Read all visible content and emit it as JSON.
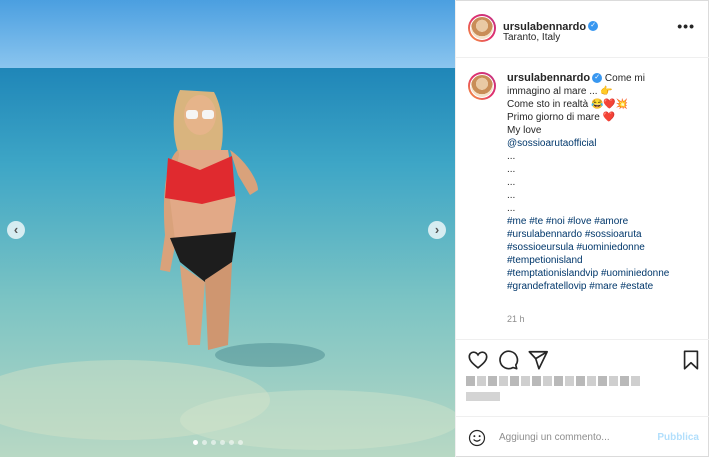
{
  "post": {
    "username": "ursulabennardo",
    "location": "Taranto, Italy",
    "more_label": "•••",
    "verified_glyph": "✓",
    "caption_lines": [
      {
        "text": "Come mi",
        "emoji": ""
      },
      {
        "text": "immagino al mare ...",
        "emoji": "👉"
      },
      {
        "text": "Come sto in realtà",
        "emoji": "😂❤️💥"
      },
      {
        "text": "Primo giorno di mare",
        "emoji": "❤️"
      },
      {
        "text": "My love",
        "emoji": ""
      }
    ],
    "mention": "@sossioarutaofficial",
    "dot_lines": [
      "...",
      "...",
      "...",
      "...",
      "..."
    ],
    "hashtag_lines": [
      "#me #te #noi #love #amore",
      "#ursulabennardo #sossioaruta",
      "#sossioeursula #uominiedonne",
      "#tempetionisland",
      "#temptationislandvip #uominiedonne",
      "#grandefratellovip #mare #estate"
    ],
    "timestamp": "21 h"
  },
  "comment": {
    "placeholder": "Aggiungi un commento...",
    "publish_label": "Pubblica"
  },
  "icons": {
    "like": "heart-icon",
    "comment": "comment-icon",
    "share": "send-icon",
    "save": "bookmark-icon",
    "emoji": "smiley-icon",
    "prev": "chevron-left-icon",
    "next": "chevron-right-icon"
  },
  "nav": {
    "prev_glyph": "‹",
    "next_glyph": "›"
  },
  "colors": {
    "link": "#00376b",
    "verified": "#3897f0",
    "publish": "#b2dffc"
  }
}
